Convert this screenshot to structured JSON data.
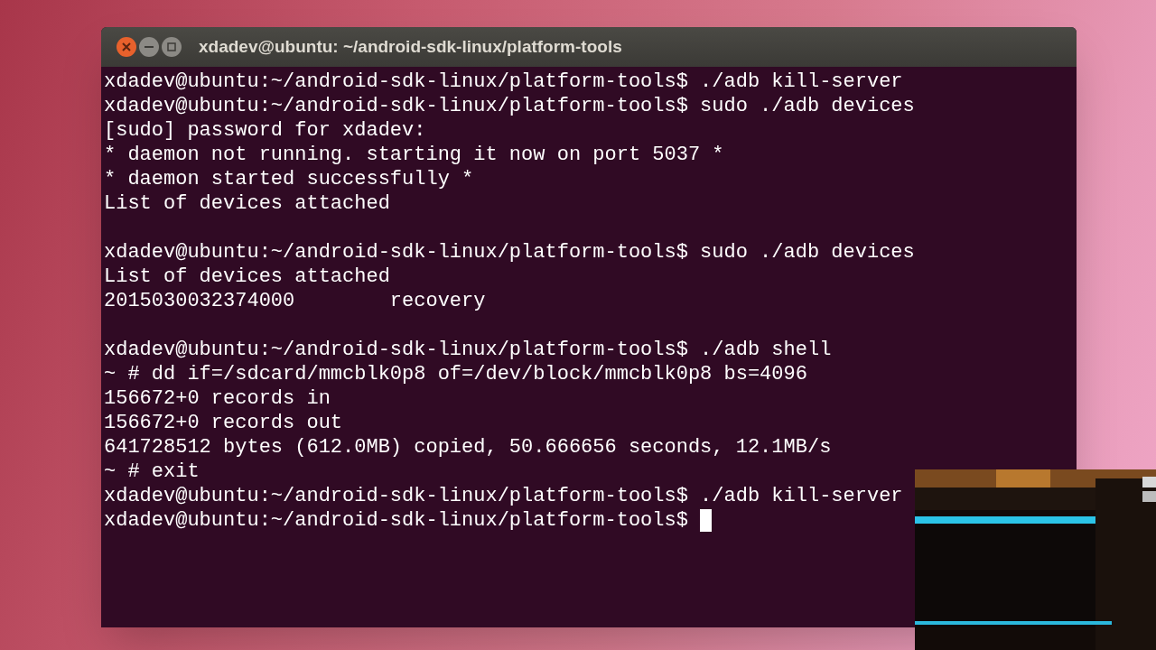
{
  "window": {
    "title": "xdadev@ubuntu: ~/android-sdk-linux/platform-tools"
  },
  "terminal": {
    "blocks": [
      [
        "xdadev@ubuntu:~/android-sdk-linux/platform-tools$ ./adb kill-server",
        "xdadev@ubuntu:~/android-sdk-linux/platform-tools$ sudo ./adb devices",
        "[sudo] password for xdadev:",
        "* daemon not running. starting it now on port 5037 *",
        "* daemon started successfully *",
        "List of devices attached"
      ],
      [
        "xdadev@ubuntu:~/android-sdk-linux/platform-tools$ sudo ./adb devices",
        "List of devices attached",
        "2015030032374000        recovery"
      ],
      [
        "xdadev@ubuntu:~/android-sdk-linux/platform-tools$ ./adb shell",
        "~ # dd if=/sdcard/mmcblk0p8 of=/dev/block/mmcblk0p8 bs=4096",
        "156672+0 records in",
        "156672+0 records out",
        "641728512 bytes (612.0MB) copied, 50.666656 seconds, 12.1MB/s",
        "~ # exit",
        "xdadev@ubuntu:~/android-sdk-linux/platform-tools$ ./adb kill-server",
        "xdadev@ubuntu:~/android-sdk-linux/platform-tools$ "
      ]
    ]
  }
}
